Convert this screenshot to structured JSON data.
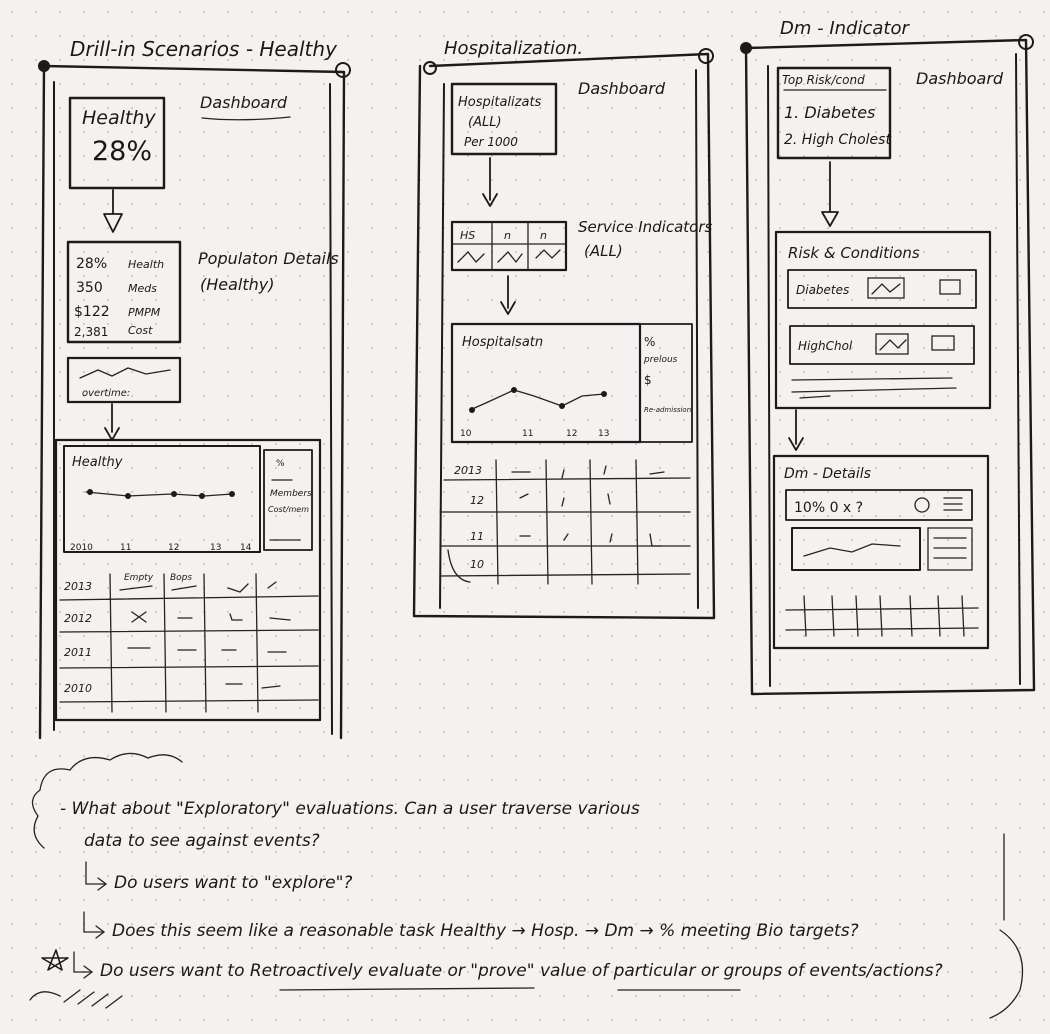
{
  "panels": {
    "healthy": {
      "title": "Drill-in Scenarios - Healthy",
      "kpi": {
        "label": "Healthy",
        "value": "28%"
      },
      "dashboard_label": "Dashboard",
      "population_details": {
        "line1": "Populaton Details",
        "line2": "(Healthy)"
      },
      "stats": [
        {
          "value": "28%",
          "label": "Health"
        },
        {
          "value": "350",
          "label": "Meds"
        },
        {
          "value": "$122",
          "label": "PMPM"
        },
        {
          "value": "2,381",
          "label": "Cost"
        }
      ],
      "overtime_label": "overtime:",
      "detail": {
        "title": "Healthy",
        "side_labels": [
          "%",
          "",
          "Members",
          "Cost/mem"
        ],
        "x_ticks": [
          "2010",
          "11",
          "12",
          "13",
          "14"
        ]
      },
      "table": {
        "headers": [
          "2013",
          "Empty",
          "Bops",
          "",
          ""
        ],
        "rows": [
          "2012",
          "2011",
          "2010"
        ]
      }
    },
    "hospitalization": {
      "title": "Hospitalization.",
      "kpi": {
        "line1": "Hospitalizats",
        "line2": "(ALL)",
        "line3": "Per 1000"
      },
      "dashboard_label": "Dashboard",
      "service_label": {
        "line1": "Service Indicators",
        "line2": "(ALL)"
      },
      "service_headers": [
        "HS",
        "n",
        "n"
      ],
      "detail": {
        "title": "Hospitalsatn",
        "side_labels": [
          "%",
          "prelous",
          "$",
          "Re-admission"
        ],
        "x_ticks": [
          "10",
          "11",
          "12",
          "13"
        ]
      },
      "table": {
        "rows": [
          "2013",
          "12",
          "11",
          "10"
        ]
      }
    },
    "dm": {
      "title": "Dm - Indicator",
      "top_list": {
        "title": "Top Risk/cond",
        "items": [
          "1. Diabetes",
          "2. High Cholest"
        ]
      },
      "dashboard_label": "Dashboard",
      "risk": {
        "title": "Risk & Conditions",
        "rows": [
          "Diabetes",
          "HighChol"
        ]
      },
      "details": {
        "title": "Dm - Details",
        "stats": "10%  0  x ?"
      }
    }
  },
  "notes": [
    "- What about \"Exploratory\" evaluations. Can a user traverse various",
    "data to see against events?",
    "Do users want to \"explore\"?",
    "Does this seem like a reasonable task Healthy → Hosp. → Dm → % meeting Bio targets?",
    "Do users want to Retroactively evaluate or \"prove\" value of particular or groups of events/actions?"
  ]
}
